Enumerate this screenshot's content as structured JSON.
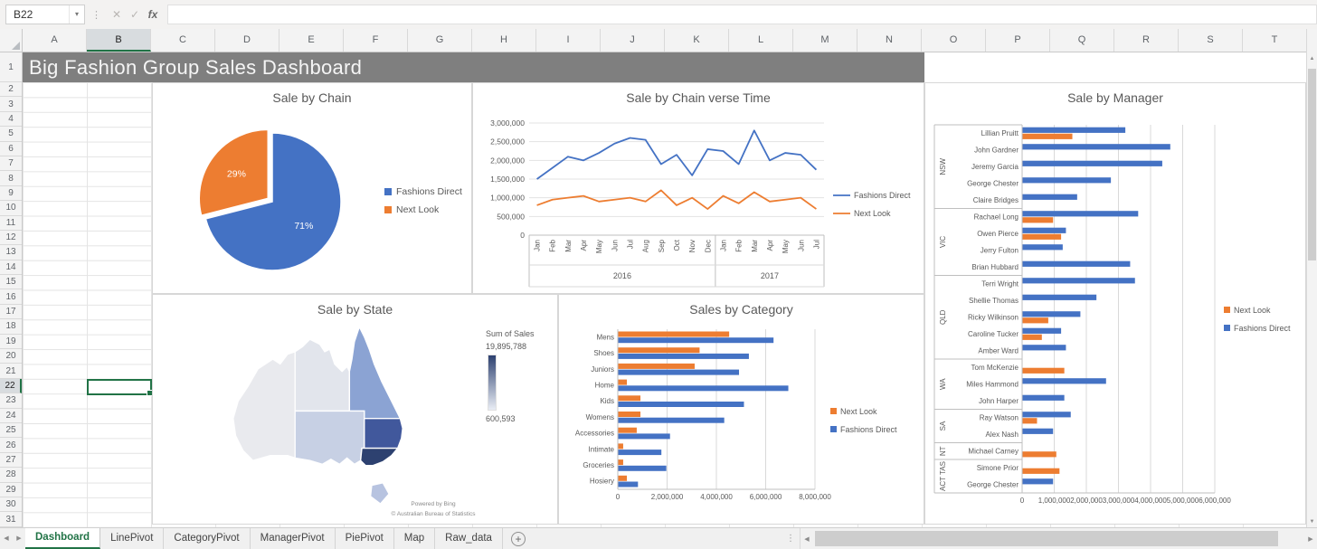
{
  "window": {
    "name_box": "B22",
    "formula_value": "",
    "fx_label": "fx"
  },
  "grid": {
    "columns": [
      "A",
      "B",
      "C",
      "D",
      "E",
      "F",
      "G",
      "H",
      "I",
      "J",
      "K",
      "L",
      "M",
      "N",
      "O",
      "P",
      "Q",
      "R",
      "S",
      "T"
    ],
    "rows": [
      "1",
      "2",
      "3",
      "4",
      "5",
      "6",
      "7",
      "8",
      "9",
      "10",
      "11",
      "12",
      "13",
      "14",
      "15",
      "16",
      "17",
      "18",
      "19",
      "20",
      "21",
      "22",
      "23",
      "24",
      "25",
      "26",
      "27",
      "28",
      "29",
      "30",
      "31"
    ],
    "selected_column": "B",
    "selected_row": "22",
    "title_banner": "Big Fashion Group Sales Dashboard"
  },
  "tabs": {
    "items": [
      "Dashboard",
      "LinePivot",
      "CategoryPivot",
      "ManagerPivot",
      "PiePivot",
      "Map",
      "Raw_data"
    ],
    "active": "Dashboard",
    "add_label": "+"
  },
  "colors": {
    "fashions_direct": "#4472C4",
    "next_look": "#ED7D31",
    "accent_green": "#217346",
    "banner_gray": "#7F7F7F"
  },
  "chart_data": [
    {
      "id": "sale_by_chain",
      "type": "pie",
      "title": "Sale by Chain",
      "labels": [
        "Fashions Direct",
        "Next Look"
      ],
      "values": [
        71,
        29
      ],
      "value_labels": [
        "71%",
        "29%"
      ],
      "colors": [
        "#4472C4",
        "#ED7D31"
      ],
      "exploded_slice": "Next Look",
      "legend": [
        {
          "label": "Fashions Direct",
          "color": "#4472C4"
        },
        {
          "label": "Next Look",
          "color": "#ED7D31"
        }
      ]
    },
    {
      "id": "sale_by_chain_verse_time",
      "type": "line",
      "title": "Sale by Chain verse Time",
      "x": [
        "Jan",
        "Feb",
        "Mar",
        "Apr",
        "May",
        "Jun",
        "Jul",
        "Aug",
        "Sep",
        "Oct",
        "Nov",
        "Dec",
        "Jan",
        "Feb",
        "Mar",
        "Apr",
        "May",
        "Jun",
        "Jul"
      ],
      "year_groups": [
        {
          "label": "2016",
          "span": 12
        },
        {
          "label": "2017",
          "span": 7
        }
      ],
      "ylim": [
        0,
        3000000
      ],
      "yticks": [
        "0",
        "500,000",
        "1,000,000",
        "1,500,000",
        "2,000,000",
        "2,500,000",
        "3,000,000"
      ],
      "series": [
        {
          "name": "Fashions Direct",
          "color": "#4472C4",
          "values": [
            1500000,
            1800000,
            2100000,
            2000000,
            2200000,
            2450000,
            2600000,
            2550000,
            1900000,
            2150000,
            1600000,
            2300000,
            2250000,
            1900000,
            2800000,
            2000000,
            2200000,
            2150000,
            1750000
          ]
        },
        {
          "name": "Next Look",
          "color": "#ED7D31",
          "values": [
            800000,
            950000,
            1000000,
            1050000,
            900000,
            950000,
            1000000,
            900000,
            1200000,
            800000,
            1000000,
            700000,
            1050000,
            850000,
            1150000,
            900000,
            950000,
            1000000,
            700000
          ]
        }
      ],
      "legend": [
        {
          "label": "Fashions Direct",
          "color": "#4472C4"
        },
        {
          "label": "Next Look",
          "color": "#ED7D31"
        }
      ]
    },
    {
      "id": "sale_by_manager",
      "type": "bar",
      "orientation": "horizontal",
      "title": "Sale by Manager",
      "categories": [
        "Lillian Pruitt",
        "John Gardner",
        "Jeremy Garcia",
        "George Chester",
        "Claire Bridges",
        "Rachael Long",
        "Owen Pierce",
        "Jerry Fulton",
        "Brian Hubbard",
        "Terri Wright",
        "Shellie Thomas",
        "Ricky Wilkinson",
        "Caroline Tucker",
        "Amber Ward",
        "Tom McKenzie",
        "Miles Hammond",
        "John Harper",
        "Ray Watson",
        "Alex Nash",
        "Michael Carney",
        "Simone Prior",
        "George Chester"
      ],
      "state_groups": [
        {
          "label": "NSW",
          "span": 5
        },
        {
          "label": "VIC",
          "span": 4
        },
        {
          "label": "QLD",
          "span": 5
        },
        {
          "label": "WA",
          "span": 3
        },
        {
          "label": "SA",
          "span": 2
        },
        {
          "label": "NT",
          "span": 1
        },
        {
          "label": "ACT TAS",
          "span": 2
        }
      ],
      "xlim": [
        0,
        6000000
      ],
      "xticks": [
        "0",
        "1,000,000",
        "2,000,000",
        "3,000,000",
        "4,000,000",
        "5,000,000",
        "6,000,000"
      ],
      "series": [
        {
          "name": "Fashions Direct",
          "color": "#4472C4",
          "values": [
            3200000,
            4600000,
            4350000,
            2750000,
            1700000,
            3600000,
            1350000,
            1250000,
            3350000,
            3500000,
            2300000,
            1800000,
            1200000,
            1350000,
            0,
            2600000,
            1300000,
            1500000,
            950000,
            0,
            0,
            950000
          ]
        },
        {
          "name": "Next Look",
          "color": "#ED7D31",
          "values": [
            1550000,
            0,
            0,
            0,
            0,
            950000,
            1200000,
            0,
            0,
            0,
            0,
            800000,
            600000,
            0,
            1300000,
            0,
            0,
            450000,
            0,
            1050000,
            1150000,
            0
          ]
        }
      ],
      "legend": [
        {
          "label": "Next Look",
          "color": "#ED7D31"
        },
        {
          "label": "Fashions Direct",
          "color": "#4472C4"
        }
      ]
    },
    {
      "id": "sales_by_category",
      "type": "bar",
      "orientation": "horizontal",
      "title": "Sales by Category",
      "categories": [
        "Mens",
        "Shoes",
        "Juniors",
        "Home",
        "Kids",
        "Womens",
        "Accessories",
        "Intimate",
        "Groceries",
        "Hosiery"
      ],
      "xlim": [
        0,
        8000000
      ],
      "xticks": [
        "0",
        "2,000,000",
        "4,000,000",
        "6,000,000",
        "8,000,000"
      ],
      "series": [
        {
          "name": "Next Look",
          "color": "#ED7D31",
          "values": [
            4500000,
            3300000,
            3100000,
            350000,
            900000,
            900000,
            750000,
            200000,
            200000,
            350000
          ]
        },
        {
          "name": "Fashions Direct",
          "color": "#4472C4",
          "values": [
            6300000,
            5300000,
            4900000,
            6900000,
            5100000,
            4300000,
            2100000,
            1750000,
            1950000,
            800000
          ]
        }
      ],
      "legend": [
        {
          "label": "Next Look",
          "color": "#ED7D31"
        },
        {
          "label": "Fashions Direct",
          "color": "#4472C4"
        }
      ]
    },
    {
      "id": "sale_by_state",
      "type": "map",
      "title": "Sale by State",
      "legend_title": "Sum of Sales",
      "legend_max": "19,895,788",
      "legend_min": "600,593",
      "legend_gradient": [
        "#2d4170",
        "#e9edf5"
      ],
      "attribution": [
        "Powered by Bing",
        "© Australian Bureau of Statistics"
      ],
      "states": [
        {
          "id": "wa",
          "name": "WA",
          "color": "#e9eaee"
        },
        {
          "id": "nt",
          "name": "NT",
          "color": "#e2e5ec"
        },
        {
          "id": "sa",
          "name": "SA",
          "color": "#c7d0e4"
        },
        {
          "id": "qld",
          "name": "QLD",
          "color": "#8ba3d3"
        },
        {
          "id": "nsw",
          "name": "NSW",
          "color": "#41589c"
        },
        {
          "id": "vic",
          "name": "VIC",
          "color": "#2d4170"
        },
        {
          "id": "tas",
          "name": "TAS",
          "color": "#b7c3e0"
        }
      ]
    }
  ]
}
